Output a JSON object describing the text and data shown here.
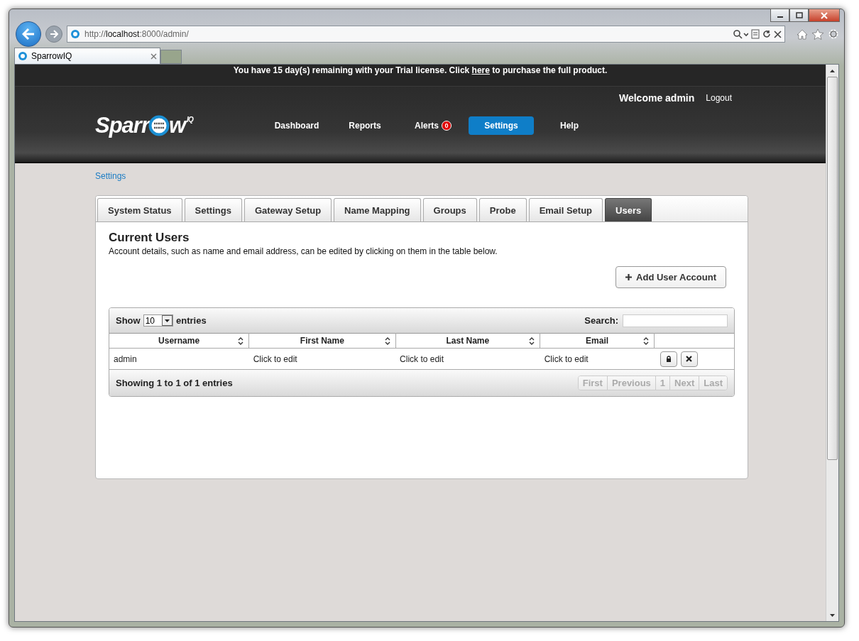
{
  "browser": {
    "url": "http://**localhost**:8000/admin/",
    "tabs": [
      {
        "title": "SparrowIQ",
        "selected": true
      }
    ]
  },
  "trial_banner": {
    "before": "You have 15 day(s) remaining with your Trial license. Click",
    "link": "here",
    "after": "to purchase the full product."
  },
  "header": {
    "logo": {
      "before": "Sparr",
      "after": "w",
      "superscript": "IQ"
    },
    "welcome": "Welcome admin",
    "logout": "Logout"
  },
  "nav": [
    {
      "label": "Dashboard",
      "selected": false
    },
    {
      "label": "Reports",
      "selected": false
    },
    {
      "label": "Alerts",
      "selected": false,
      "badge": "0"
    },
    {
      "label": "Settings",
      "selected": true
    },
    {
      "label": "Help",
      "selected": false
    }
  ],
  "breadcrumb": "Settings",
  "tabs": [
    {
      "label": "System Status",
      "selected": false
    },
    {
      "label": "Settings",
      "selected": false
    },
    {
      "label": "Gateway Setup",
      "selected": false
    },
    {
      "label": "Name Mapping",
      "selected": false
    },
    {
      "label": "Groups",
      "selected": false
    },
    {
      "label": "Probe",
      "selected": false
    },
    {
      "label": "Email Setup",
      "selected": false
    },
    {
      "label": "Users",
      "selected": true
    }
  ],
  "section": {
    "title": "Current Users",
    "description": "Account details, such as name and email address, can be edited by clicking on them in the table below.",
    "add_button": "Add User Account"
  },
  "table": {
    "show_label": "Show",
    "length": "10",
    "entries_label": "entries",
    "search_label": "Search:",
    "columns": [
      "Username",
      "First Name",
      "Last Name",
      "Email"
    ],
    "rows": [
      [
        "admin",
        "Click to edit",
        "Click to edit",
        "Click to edit"
      ]
    ],
    "info": "Showing 1 to 1 of 1 entries",
    "pagination": [
      {
        "label": "First",
        "disabled": true
      },
      {
        "label": "Previous",
        "disabled": true
      },
      {
        "label": "1",
        "disabled": true
      },
      {
        "label": "Next",
        "disabled": true
      },
      {
        "label": "Last",
        "disabled": true
      }
    ]
  }
}
